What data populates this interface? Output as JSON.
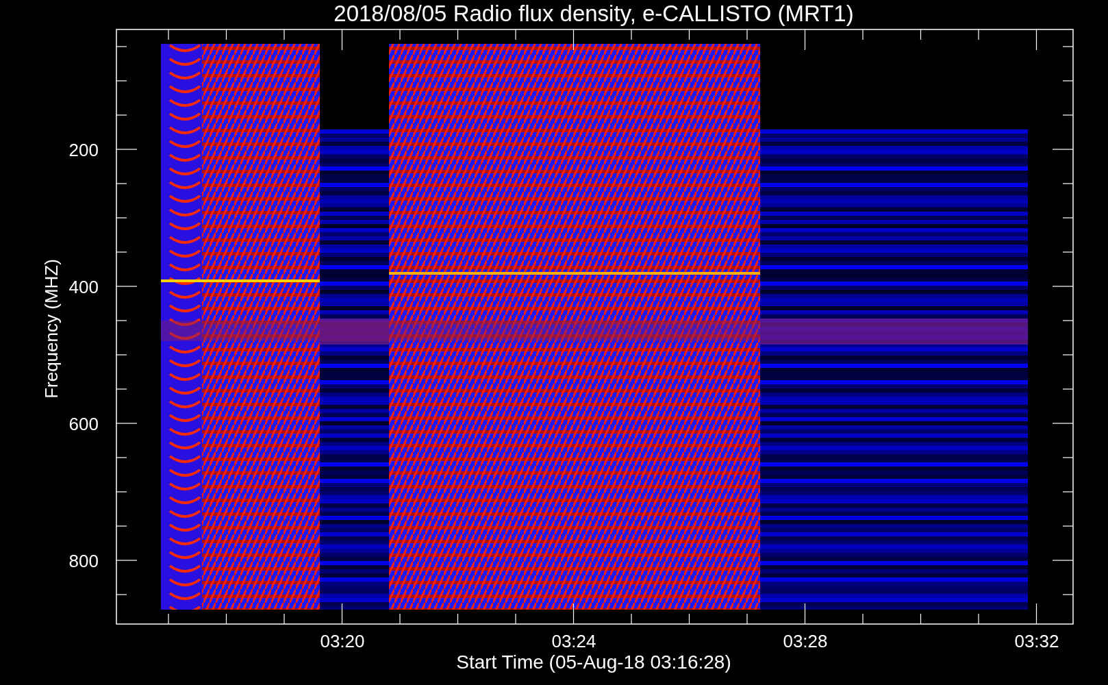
{
  "title": "2018/08/05  Radio flux density, e-CALLISTO (MRT1)",
  "plot": {
    "ylabel": "Frequency (MHZ)",
    "xlabel": "Start Time (05-Aug-18 03:16:28)",
    "y_tick_labels": [
      "200",
      "400",
      "600",
      "800"
    ],
    "x_tick_labels": [
      "03:20",
      "03:24",
      "03:28",
      "03:32"
    ]
  }
}
